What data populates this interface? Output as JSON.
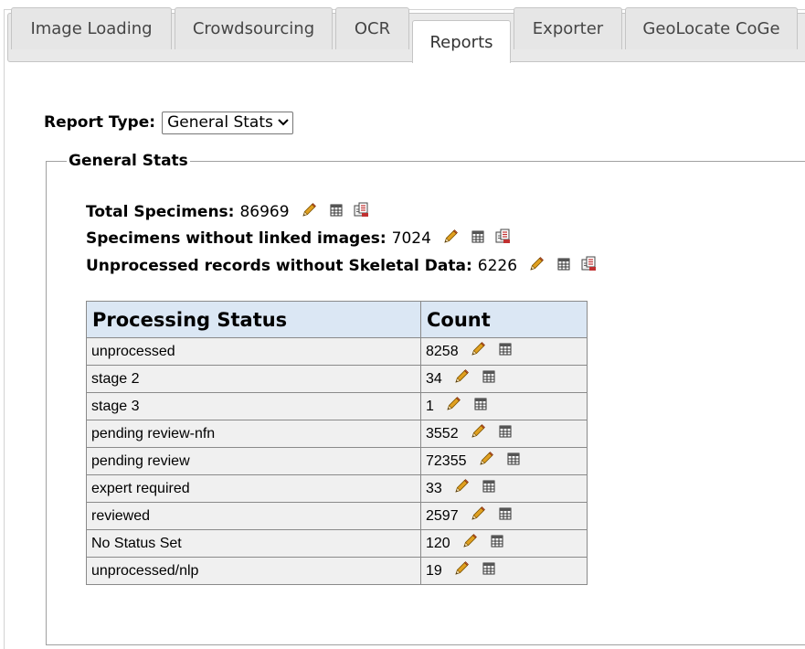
{
  "tabs": [
    {
      "label": "Image Loading",
      "active": false
    },
    {
      "label": "Crowdsourcing",
      "active": false
    },
    {
      "label": "OCR",
      "active": false
    },
    {
      "label": "Reports",
      "active": true
    },
    {
      "label": "Exporter",
      "active": false
    },
    {
      "label": "GeoLocate CoGe",
      "active": false
    }
  ],
  "report": {
    "type_label": "Report Type:",
    "selected": "General Stats"
  },
  "general_stats": {
    "legend": "General Stats",
    "total": {
      "label": "Total Specimens:",
      "value": "86969"
    },
    "without_images": {
      "label": "Specimens without linked images:",
      "value": "7024"
    },
    "unprocessed_no_skeletal": {
      "label": "Unprocessed records without Skeletal Data:",
      "value": "6226"
    }
  },
  "table": {
    "headers": [
      "Processing Status",
      "Count"
    ],
    "rows": [
      {
        "status": "unprocessed",
        "count": "8258"
      },
      {
        "status": "stage 2",
        "count": "34"
      },
      {
        "status": "stage 3",
        "count": "1"
      },
      {
        "status": "pending review-nfn",
        "count": "3552"
      },
      {
        "status": "pending review",
        "count": "72355"
      },
      {
        "status": "expert required",
        "count": "33"
      },
      {
        "status": "reviewed",
        "count": "2597"
      },
      {
        "status": "No Status Set",
        "count": "120"
      },
      {
        "status": "unprocessed/nlp",
        "count": "19"
      }
    ]
  },
  "icons": {
    "edit": "pencil-icon",
    "list": "table-icon",
    "copy": "copy-records-icon"
  },
  "colors": {
    "header_bg": "#dbe7f4",
    "cell_bg": "#f0f0f0",
    "tab_bg": "#e6e6e6",
    "active_tab_bg": "#ffffff"
  }
}
